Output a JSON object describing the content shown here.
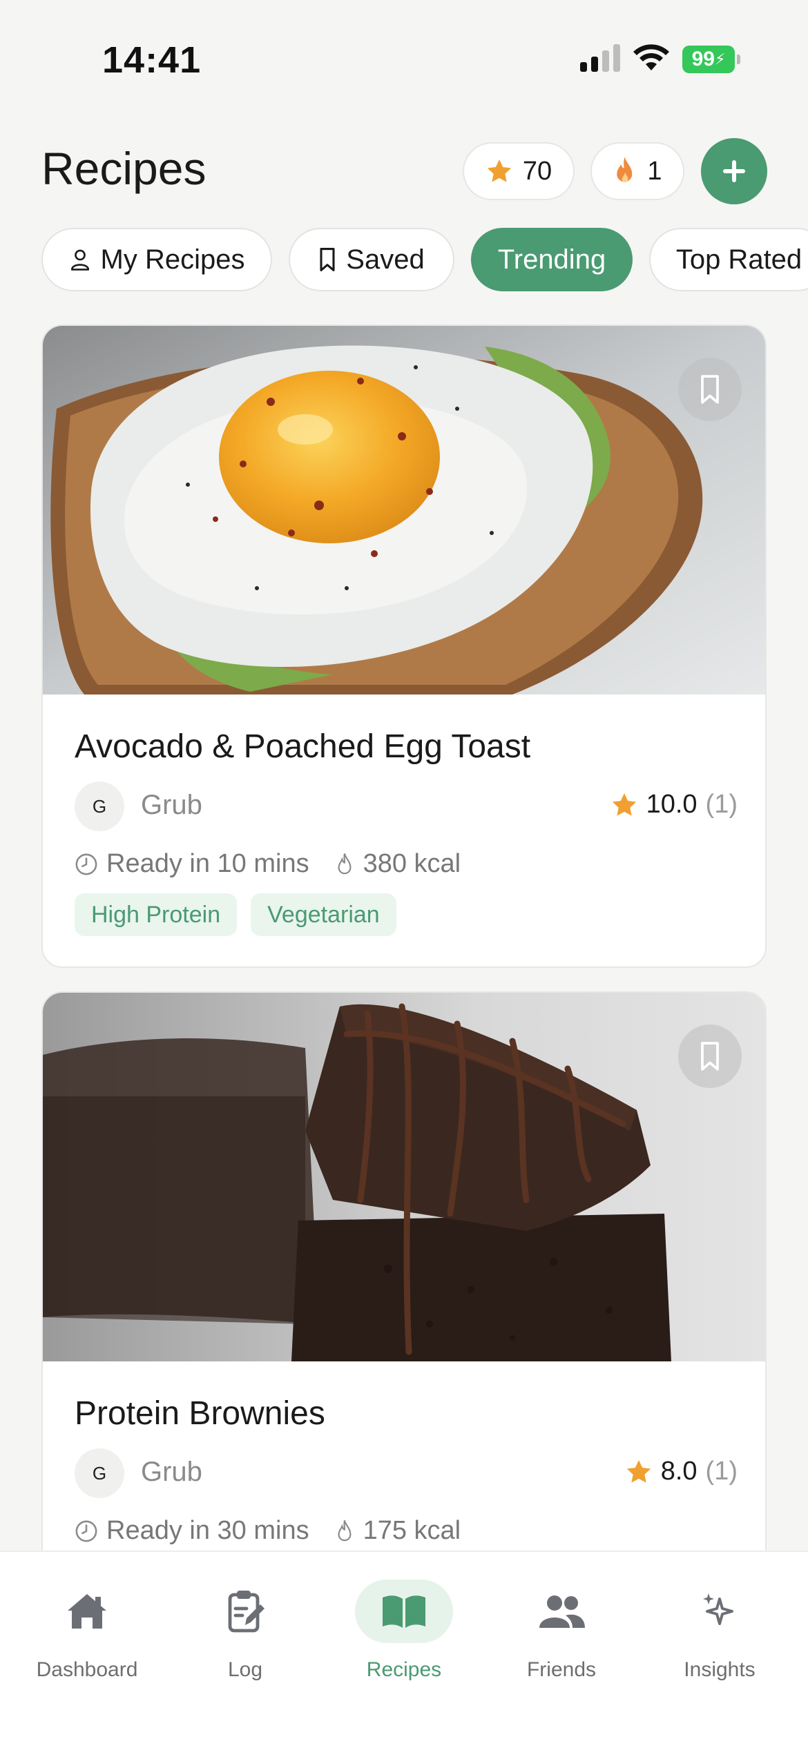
{
  "status_bar": {
    "time": "14:41",
    "battery": "99"
  },
  "header": {
    "title": "Recipes",
    "points": "70",
    "streak": "1"
  },
  "filters": [
    {
      "label": "My Recipes",
      "icon": "person-icon",
      "active": false
    },
    {
      "label": "Saved",
      "icon": "bookmark-icon",
      "active": false
    },
    {
      "label": "Trending",
      "active": true
    },
    {
      "label": "Top Rated",
      "active": false
    }
  ],
  "recipes": [
    {
      "title": "Avocado & Poached Egg Toast",
      "author_initial": "G",
      "author": "Grub",
      "rating": "10.0",
      "rating_count": "(1)",
      "ready": "Ready in 10 mins",
      "calories": "380 kcal",
      "tags": [
        "High Protein",
        "Vegetarian"
      ]
    },
    {
      "title": "Protein Brownies",
      "author_initial": "G",
      "author": "Grub",
      "rating": "8.0",
      "rating_count": "(1)",
      "ready": "Ready in 30 mins",
      "calories": "175 kcal",
      "tags": []
    }
  ],
  "nav": [
    {
      "label": "Dashboard",
      "icon": "home-icon",
      "active": false
    },
    {
      "label": "Log",
      "icon": "clipboard-edit-icon",
      "active": false
    },
    {
      "label": "Recipes",
      "icon": "open-book-icon",
      "active": true
    },
    {
      "label": "Friends",
      "icon": "people-icon",
      "active": false
    },
    {
      "label": "Insights",
      "icon": "sparkles-icon",
      "active": false
    }
  ],
  "colors": {
    "accent": "#4a9a72",
    "accent_light": "#e6f3ea",
    "star": "#f0a030",
    "flame": "#f08a3c",
    "background": "#f5f5f3"
  }
}
